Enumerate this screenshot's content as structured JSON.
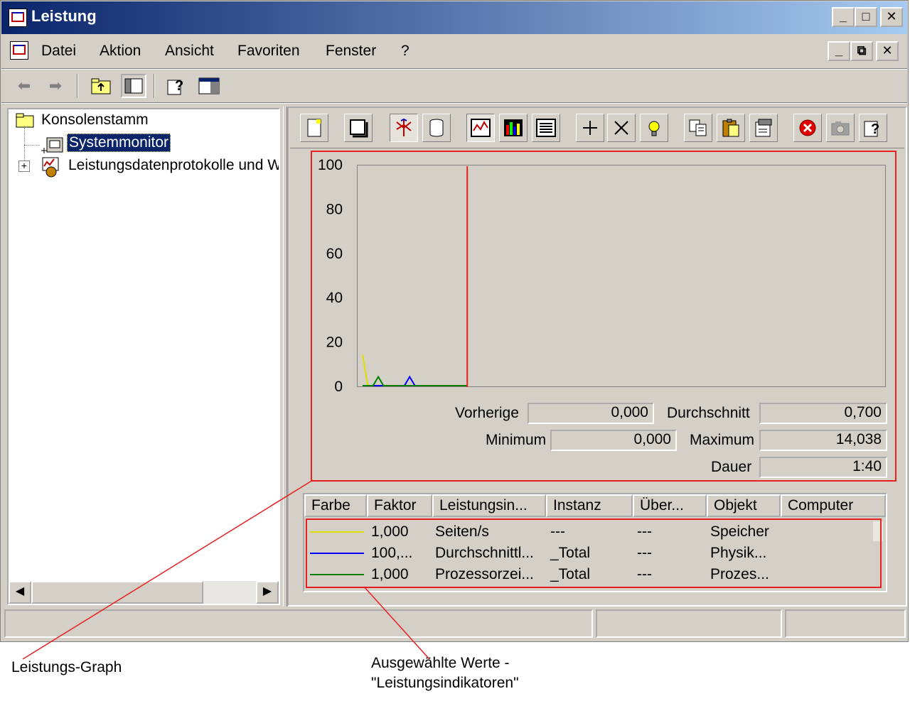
{
  "window": {
    "title": "Leistung"
  },
  "menu": [
    "Datei",
    "Aktion",
    "Ansicht",
    "Favoriten",
    "Fenster",
    "?"
  ],
  "tree": {
    "root": "Konsolenstamm",
    "items": [
      {
        "label": "Systemmonitor",
        "selected": true
      },
      {
        "label": "Leistungsdatenprotokolle und Warnungen",
        "selected": false
      }
    ]
  },
  "graph_toolbar": {
    "icons": [
      "new-counter-set-icon",
      "clear-display-icon",
      "current-activity-icon",
      "log-data-icon",
      "view-graph-icon",
      "view-histogram-icon",
      "view-report-icon",
      "add-icon",
      "delete-icon",
      "highlight-icon",
      "copy-properties-icon",
      "paste-counter-list-icon",
      "properties-icon",
      "freeze-display-icon",
      "update-data-icon",
      "help-icon"
    ]
  },
  "chart_data": {
    "type": "line",
    "ylim": [
      0,
      100
    ],
    "yticks": [
      "100",
      "80",
      "60",
      "40",
      "20",
      "0"
    ],
    "series": [
      {
        "color": "#e0e000",
        "x": [
          0,
          1,
          2,
          3,
          4,
          5,
          6,
          7,
          8,
          9,
          10,
          11,
          12,
          13,
          14,
          15,
          16,
          17,
          18,
          19,
          20
        ],
        "values": [
          14.038,
          0,
          0,
          0,
          0,
          0,
          0,
          0,
          0,
          0,
          0,
          0,
          0,
          0,
          0,
          0,
          0,
          0,
          0,
          0,
          0
        ]
      },
      {
        "color": "#0000ff",
        "x": [
          0,
          1,
          2,
          3,
          4,
          5,
          6,
          7,
          8,
          9,
          10,
          11,
          12,
          13,
          14,
          15,
          16,
          17,
          18,
          19,
          20
        ],
        "values": [
          0,
          0,
          0,
          0,
          0,
          0,
          0,
          0,
          0,
          4,
          0,
          0,
          0,
          0,
          0,
          0,
          0,
          0,
          0,
          0,
          0
        ]
      },
      {
        "color": "#008000",
        "x": [
          0,
          1,
          2,
          3,
          4,
          5,
          6,
          7,
          8,
          9,
          10,
          11,
          12,
          13,
          14,
          15,
          16,
          17,
          18,
          19,
          20
        ],
        "values": [
          0,
          0,
          0,
          4,
          0,
          0,
          0,
          0,
          0,
          0,
          0,
          0,
          0,
          0,
          0,
          0,
          0,
          0,
          0,
          0,
          0
        ]
      }
    ],
    "current_position_x": 20,
    "x_capacity": 100,
    "grid": false
  },
  "stats": {
    "vorherige_label": "Vorherige",
    "vorherige": "0,000",
    "durchschnitt_label": "Durchschnitt",
    "durchschnitt": "0,700",
    "minimum_label": "Minimum",
    "minimum": "0,000",
    "maximum_label": "Maximum",
    "maximum": "14,038",
    "dauer_label": "Dauer",
    "dauer": "1:40"
  },
  "counters": {
    "headers": [
      "Farbe",
      "Faktor",
      "Leistungsin...",
      "Instanz",
      "Über...",
      "Objekt",
      "Computer"
    ],
    "rows": [
      {
        "color": "#e0e000",
        "faktor": "1,000",
        "counter": "Seiten/s",
        "instanz": "---",
        "ueber": "---",
        "objekt": "Speicher"
      },
      {
        "color": "#0000ff",
        "faktor": "100,...",
        "counter": "Durchschnittl...",
        "instanz": "_Total",
        "ueber": "---",
        "objekt": "Physik..."
      },
      {
        "color": "#008000",
        "faktor": "1,000",
        "counter": "Prozessorzei...",
        "instanz": "_Total",
        "ueber": "---",
        "objekt": "Prozes..."
      }
    ]
  },
  "annotations": {
    "graph": "Leistungs-Graph",
    "values_line1": "Ausgewählte Werte -",
    "values_line2": "\"Leistungsindikatoren\""
  }
}
